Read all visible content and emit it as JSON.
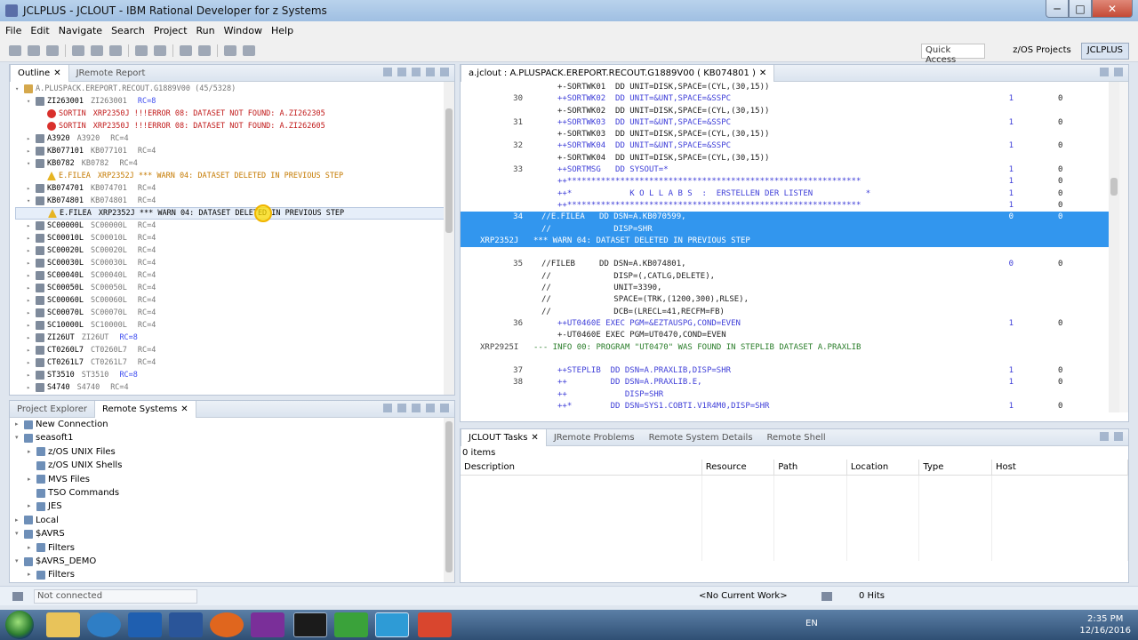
{
  "window": {
    "title": "JCLPLUS - JCLOUT - IBM Rational Developer for z Systems",
    "minimize": "─",
    "maximize": "□",
    "close": "✕"
  },
  "menu": [
    "File",
    "Edit",
    "Navigate",
    "Search",
    "Project",
    "Run",
    "Window",
    "Help"
  ],
  "quick_access": "Quick Access",
  "perspectives": [
    {
      "label": "z/OS Projects",
      "active": false
    },
    {
      "label": "JCLPLUS",
      "active": true
    }
  ],
  "outline": {
    "tabs": [
      "Outline",
      "JRemote Report"
    ],
    "root": {
      "name": "A.PLUSPACK.EREPORT.RECOUT.G1889V00",
      "count": "(45/5328)"
    },
    "items": [
      {
        "text": "ZI263001",
        "sub": "ZI263001",
        "rc": "RC=8",
        "rc_class": "blue",
        "level": 1,
        "type": "job",
        "tw": "▾"
      },
      {
        "text": "SORTIN",
        "sub": "XRP2350J !!!ERROR 08: DATASET NOT FOUND: A.ZI262305",
        "level": 2,
        "type": "err",
        "cls": "red"
      },
      {
        "text": "SORTIN",
        "sub": "XRP2350J !!!ERROR 08: DATASET NOT FOUND: A.ZI262605",
        "level": 2,
        "type": "err",
        "cls": "red"
      },
      {
        "text": "A3920",
        "sub": "A3920",
        "rc": "RC=4",
        "level": 1,
        "type": "job",
        "tw": "▸"
      },
      {
        "text": "KB077101",
        "sub": "KB077101",
        "rc": "RC=4",
        "level": 1,
        "type": "job",
        "tw": "▸"
      },
      {
        "text": "KB0782",
        "sub": "KB0782",
        "rc": "RC=4",
        "level": 1,
        "type": "job",
        "tw": "▾"
      },
      {
        "text": "E.FILEA",
        "sub": "XRP2352J *** WARN 04: DATASET DELETED IN PREVIOUS STEP",
        "level": 2,
        "type": "warn",
        "cls": "orange"
      },
      {
        "text": "KB074701",
        "sub": "KB074701",
        "rc": "RC=4",
        "level": 1,
        "type": "job",
        "tw": "▸"
      },
      {
        "text": "KB074801",
        "sub": "KB074801",
        "rc": "RC=4",
        "level": 1,
        "type": "job",
        "tw": "▾"
      },
      {
        "text": "E.FILEA",
        "sub": "XRP2352J *** WARN 04: DATASET DELETED IN PREVIOUS STEP",
        "level": 2,
        "type": "warn",
        "cls": "dark",
        "selected": true
      },
      {
        "text": "SC00000L",
        "sub": "SC00000L",
        "rc": "RC=4",
        "level": 1,
        "type": "job",
        "tw": "▸"
      },
      {
        "text": "SC00010L",
        "sub": "SC00010L",
        "rc": "RC=4",
        "level": 1,
        "type": "job",
        "tw": "▸"
      },
      {
        "text": "SC00020L",
        "sub": "SC00020L",
        "rc": "RC=4",
        "level": 1,
        "type": "job",
        "tw": "▸"
      },
      {
        "text": "SC00030L",
        "sub": "SC00030L",
        "rc": "RC=4",
        "level": 1,
        "type": "job",
        "tw": "▸"
      },
      {
        "text": "SC00040L",
        "sub": "SC00040L",
        "rc": "RC=4",
        "level": 1,
        "type": "job",
        "tw": "▸"
      },
      {
        "text": "SC00050L",
        "sub": "SC00050L",
        "rc": "RC=4",
        "level": 1,
        "type": "job",
        "tw": "▸"
      },
      {
        "text": "SC00060L",
        "sub": "SC00060L",
        "rc": "RC=4",
        "level": 1,
        "type": "job",
        "tw": "▸"
      },
      {
        "text": "SC00070L",
        "sub": "SC00070L",
        "rc": "RC=4",
        "level": 1,
        "type": "job",
        "tw": "▸"
      },
      {
        "text": "SC10000L",
        "sub": "SC10000L",
        "rc": "RC=4",
        "level": 1,
        "type": "job",
        "tw": "▸"
      },
      {
        "text": "ZI26UT",
        "sub": "ZI26UT",
        "rc": "RC=8",
        "rc_class": "blue",
        "level": 1,
        "type": "job",
        "tw": "▸"
      },
      {
        "text": "CT0260L7",
        "sub": "CT0260L7",
        "rc": "RC=4",
        "level": 1,
        "type": "job",
        "tw": "▸"
      },
      {
        "text": "CT0261L7",
        "sub": "CT0261L7",
        "rc": "RC=4",
        "level": 1,
        "type": "job",
        "tw": "▸"
      },
      {
        "text": "ST3510",
        "sub": "ST3510",
        "rc": "RC=8",
        "rc_class": "blue",
        "level": 1,
        "type": "job",
        "tw": "▸"
      },
      {
        "text": "S4740",
        "sub": "S4740",
        "rc": "RC=4",
        "level": 1,
        "type": "job",
        "tw": "▸"
      }
    ]
  },
  "remote": {
    "tabs": [
      "Project Explorer",
      "Remote Systems"
    ],
    "items": [
      {
        "text": "New Connection",
        "level": 0,
        "tw": "▸"
      },
      {
        "text": "seasoft1",
        "level": 0,
        "tw": "▾"
      },
      {
        "text": "z/OS UNIX Files",
        "level": 1,
        "tw": "▸"
      },
      {
        "text": "z/OS UNIX Shells",
        "level": 1,
        "tw": ""
      },
      {
        "text": "MVS Files",
        "level": 1,
        "tw": "▸"
      },
      {
        "text": "TSO Commands",
        "level": 1,
        "tw": ""
      },
      {
        "text": "JES",
        "level": 1,
        "tw": "▸"
      },
      {
        "text": "Local",
        "level": 0,
        "tw": "▸"
      },
      {
        "text": "$AVRS",
        "level": 0,
        "tw": "▾"
      },
      {
        "text": "Filters",
        "level": 1,
        "tw": "▸"
      },
      {
        "text": "$AVRS_DEMO",
        "level": 0,
        "tw": "▾"
      },
      {
        "text": "Filters",
        "level": 1,
        "tw": "▸"
      }
    ]
  },
  "editor": {
    "tab": "a.jclout : A.PLUSPACK.EREPORT.RECOUT.G1889V00 ( KB074801 )",
    "lines": [
      {
        "n": "",
        "code": "+-SORTWK01  DD UNIT=DISK,SPACE=(CYL,(30,15))",
        "c1": "",
        "c2": "",
        "cls": "c-dark"
      },
      {
        "n": "30",
        "code": "++SORTWK02  DD UNIT=&UNT,SPACE=&SSPC",
        "c1": "1",
        "c2": "0",
        "cls": "c-blue"
      },
      {
        "n": "",
        "code": "+-SORTWK02  DD UNIT=DISK,SPACE=(CYL,(30,15))",
        "c1": "",
        "c2": "",
        "cls": "c-dark"
      },
      {
        "n": "31",
        "code": "++SORTWK03  DD UNIT=&UNT,SPACE=&SSPC",
        "c1": "1",
        "c2": "0",
        "cls": "c-blue"
      },
      {
        "n": "",
        "code": "+-SORTWK03  DD UNIT=DISK,SPACE=(CYL,(30,15))",
        "c1": "",
        "c2": "",
        "cls": "c-dark"
      },
      {
        "n": "32",
        "code": "++SORTWK04  DD UNIT=&UNT,SPACE=&SSPC",
        "c1": "1",
        "c2": "0",
        "cls": "c-blue"
      },
      {
        "n": "",
        "code": "+-SORTWK04  DD UNIT=DISK,SPACE=(CYL,(30,15))",
        "c1": "",
        "c2": "",
        "cls": "c-dark"
      },
      {
        "n": "33",
        "code": "++SORTMSG   DD SYSOUT=*",
        "c1": "1",
        "c2": "0",
        "cls": "c-blue"
      },
      {
        "n": "",
        "code": "++*************************************************************",
        "c1": "1",
        "c2": "0",
        "cls": "c-blue"
      },
      {
        "n": "",
        "code": "++*            K O L L A B S  :  ERSTELLEN DER LISTEN           *",
        "c1": "1",
        "c2": "0",
        "cls": "c-blue"
      },
      {
        "n": "",
        "code": "++*************************************************************",
        "c1": "1",
        "c2": "0",
        "cls": "c-blue"
      },
      {
        "n": "34",
        "code": "//E.FILEA   DD DSN=A.KB070599,",
        "c1": "0",
        "c2": "0",
        "cls": "",
        "hl": true,
        "indent": "short"
      },
      {
        "n": "",
        "code": "//             DISP=SHR",
        "c1": "",
        "c2": "",
        "cls": "",
        "hl": true,
        "indent": "short"
      },
      {
        "n": "XRP2352J",
        "code": "*** WARN 04: DATASET DELETED IN PREVIOUS STEP",
        "c1": "",
        "c2": "",
        "cls": "",
        "hl": true,
        "msg": true
      },
      {
        "n": "",
        "code": "",
        "c1": "",
        "c2": "",
        "cls": ""
      },
      {
        "n": "35",
        "code": "//FILEB     DD DSN=A.KB074801,",
        "c1": "0",
        "c2": "0",
        "cls": "c-dark",
        "indent": "short"
      },
      {
        "n": "",
        "code": "//             DISP=(,CATLG,DELETE),",
        "c1": "",
        "c2": "",
        "cls": "c-dark",
        "indent": "short"
      },
      {
        "n": "",
        "code": "//             UNIT=3390,",
        "c1": "",
        "c2": "",
        "cls": "c-dark",
        "indent": "short"
      },
      {
        "n": "",
        "code": "//             SPACE=(TRK,(1200,300),RLSE),",
        "c1": "",
        "c2": "",
        "cls": "c-dark",
        "indent": "short"
      },
      {
        "n": "",
        "code": "//             DCB=(LRECL=41,RECFM=FB)",
        "c1": "",
        "c2": "",
        "cls": "c-dark",
        "indent": "short"
      },
      {
        "n": "36",
        "code": "++UT0460E EXEC PGM=&EZTAUSPG,COND=EVEN",
        "c1": "1",
        "c2": "0",
        "cls": "c-blue"
      },
      {
        "n": "",
        "code": "+-UT0460E EXEC PGM=UT0470,COND=EVEN",
        "c1": "",
        "c2": "",
        "cls": "c-dark"
      },
      {
        "n": "XRP2925I",
        "code": "--- INFO 00: PROGRAM \"UT0470\" WAS FOUND IN STEPLIB DATASET A.PRAXLIB",
        "c1": "",
        "c2": "",
        "cls": "c-green",
        "msg": true
      },
      {
        "n": "",
        "code": "",
        "c1": "",
        "c2": "",
        "cls": ""
      },
      {
        "n": "37",
        "code": "++STEPLIB  DD DSN=A.PRAXLIB,DISP=SHR",
        "c1": "1",
        "c2": "0",
        "cls": "c-blue"
      },
      {
        "n": "38",
        "code": "++         DD DSN=A.PRAXLIB.E,",
        "c1": "1",
        "c2": "0",
        "cls": "c-blue"
      },
      {
        "n": "",
        "code": "++            DISP=SHR",
        "c1": "",
        "c2": "",
        "cls": "c-blue"
      },
      {
        "n": "",
        "code": "++*        DD DSN=SYS1.COBTI.V1R4M0,DISP=SHR",
        "c1": "1",
        "c2": "0",
        "cls": "c-blue"
      }
    ]
  },
  "tasks": {
    "tabs": [
      "JCLOUT Tasks",
      "JRemote Problems",
      "Remote System Details",
      "Remote Shell"
    ],
    "count": "0 items",
    "columns": [
      "Description",
      "Resource",
      "Path",
      "Location",
      "Type",
      "Host"
    ]
  },
  "status": {
    "connection": "Not connected",
    "work": "<No Current Work>",
    "hits": "0 Hits"
  },
  "taskbar": {
    "lang": "EN",
    "time": "2:35 PM",
    "date": "12/16/2016"
  }
}
